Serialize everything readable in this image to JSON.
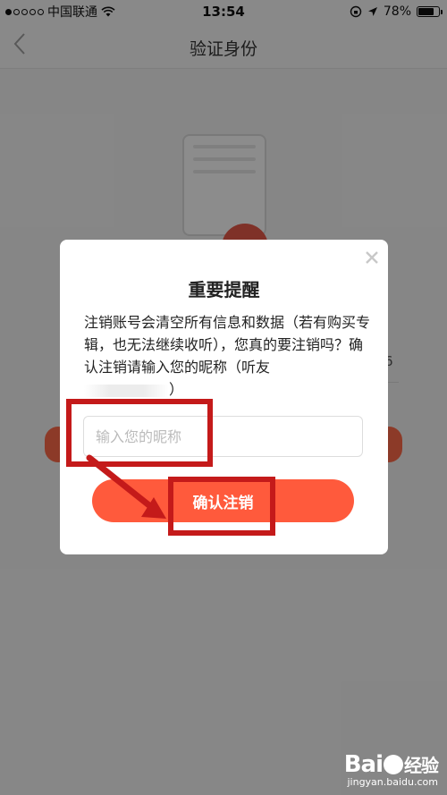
{
  "status_bar": {
    "carrier": "中国联通",
    "time": "13:54",
    "battery": "78%",
    "battery_level": 0.78
  },
  "nav": {
    "back_icon": "chevron-left-icon",
    "title": "验证身份"
  },
  "background": {
    "digit": "6"
  },
  "dialog": {
    "close_icon": "close-icon",
    "title": "重要提醒",
    "message": "注销账号会清空所有信息和数据（若有购买专辑，也无法继续收听），您真的要注销吗？确认注销请输入您的昵称（听友",
    "message_end": "）",
    "input_value": "",
    "input_placeholder": "输入您的昵称",
    "confirm_label": "确认注销"
  },
  "colors": {
    "accent": "#ff5a3c",
    "annotation": "#c41a1a"
  },
  "watermark": {
    "logo_prefix": "Bai",
    "logo_suffix": "经验",
    "url": "jingyan.baidu.com"
  }
}
